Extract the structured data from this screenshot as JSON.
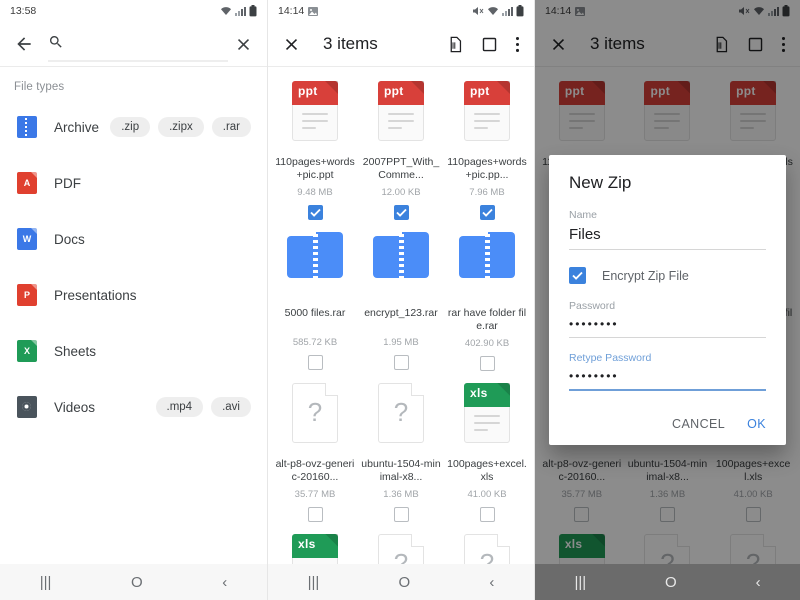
{
  "panel1": {
    "status": {
      "time": "13:58",
      "icons": [
        "wifi-icon",
        "signal-icon",
        "battery-icon"
      ]
    },
    "appbar": {
      "back_icon": "back-arrow-icon",
      "search_icon": "search-icon",
      "search_value": "",
      "search_placeholder": "",
      "clear_icon": "close-icon"
    },
    "section_label": "File types",
    "filetypes": [
      {
        "label": "Archive",
        "icon": "archive-icon",
        "icon_text": "",
        "chips": [
          ".zip",
          ".zipx",
          ".rar"
        ]
      },
      {
        "label": "PDF",
        "icon": "pdf-icon",
        "icon_text": "A",
        "chips": []
      },
      {
        "label": "Docs",
        "icon": "word-icon",
        "icon_text": "W",
        "chips": []
      },
      {
        "label": "Presentations",
        "icon": "powerpoint-icon",
        "icon_text": "P",
        "chips": []
      },
      {
        "label": "Sheets",
        "icon": "excel-icon",
        "icon_text": "X",
        "chips": []
      },
      {
        "label": "Videos",
        "icon": "video-icon",
        "icon_text": "",
        "chips": [
          ".mp4",
          ".avi"
        ]
      }
    ],
    "navbar": {
      "recents": "|||",
      "home": "O",
      "back": "‹"
    }
  },
  "panel2": {
    "status": {
      "time": "14:14",
      "icons": [
        "image-icon",
        "mute-icon",
        "wifi-icon",
        "signal-icon",
        "battery-icon"
      ]
    },
    "appbar": {
      "close_icon": "close-icon",
      "title": "3 items",
      "actions": [
        "file-shred-icon",
        "select-all-icon",
        "overflow-menu-icon"
      ]
    },
    "files": [
      {
        "name": "110pages+words+pic.ppt",
        "size": "9.48 MB",
        "kind": "ppt",
        "badge": "ppt",
        "checked": true
      },
      {
        "name": "2007PPT_With_Comme...",
        "size": "12.00 KB",
        "kind": "ppt",
        "badge": "ppt",
        "checked": true
      },
      {
        "name": "110pages+words+pic.pp...",
        "size": "7.96 MB",
        "kind": "ppt",
        "badge": "ppt",
        "checked": true
      },
      {
        "name": "5000 files.rar",
        "size": "585.72 KB",
        "kind": "rar",
        "badge": "",
        "checked": false
      },
      {
        "name": "encrypt_123.rar",
        "size": "1.95 MB",
        "kind": "rar",
        "badge": "",
        "checked": false
      },
      {
        "name": "rar have folder file.rar",
        "size": "402.90 KB",
        "kind": "rar",
        "badge": "",
        "checked": false
      },
      {
        "name": "alt-p8-ovz-generic-20160...",
        "size": "35.77 MB",
        "kind": "unknown",
        "badge": "",
        "checked": false
      },
      {
        "name": "ubuntu-1504-minimal-x8...",
        "size": "1.36 MB",
        "kind": "unknown",
        "badge": "",
        "checked": false
      },
      {
        "name": "100pages+excel.xls",
        "size": "41.00 KB",
        "kind": "xls",
        "badge": "xls",
        "checked": false
      },
      {
        "name": "",
        "size": "",
        "kind": "xls",
        "badge": "xls",
        "checked": false
      },
      {
        "name": "",
        "size": "",
        "kind": "unknown",
        "badge": "",
        "checked": false
      },
      {
        "name": "",
        "size": "",
        "kind": "unknown",
        "badge": "",
        "checked": false
      }
    ],
    "navbar": {
      "recents": "|||",
      "home": "O",
      "back": "‹"
    }
  },
  "panel3": {
    "status": {
      "time": "14:14",
      "icons": [
        "image-icon",
        "mute-icon",
        "wifi-icon",
        "signal-icon",
        "battery-icon"
      ]
    },
    "appbar": {
      "close_icon": "close-icon",
      "title": "3 items",
      "actions": [
        "file-shred-icon",
        "select-all-icon",
        "overflow-menu-icon"
      ]
    },
    "dialog": {
      "title": "New Zip",
      "name_label": "Name",
      "name_value": "Files",
      "encrypt_label": "Encrypt Zip File",
      "encrypt_checked": true,
      "password_label": "Password",
      "password_value": "••••••••",
      "retype_label": "Retype Password",
      "retype_value": "••••••••",
      "cancel_label": "CANCEL",
      "ok_label": "OK"
    },
    "navbar": {
      "recents": "|||",
      "home": "O",
      "back": "‹"
    }
  },
  "colors": {
    "accent_blue": "#3b82dd",
    "ppt_red": "#d8403a",
    "xls_green": "#1f9b57",
    "rar_blue": "#4b8df8",
    "scrim": "rgba(0,0,0,.45)"
  }
}
